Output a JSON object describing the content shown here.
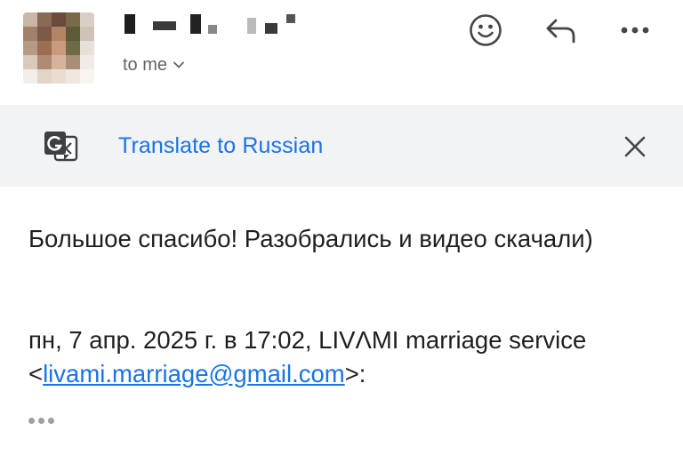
{
  "header": {
    "recipient_text": "to me",
    "icons": [
      "emoji-icon",
      "reply-icon",
      "more-icon"
    ]
  },
  "translate_bar": {
    "link_label": "Translate to Russian",
    "icon": "google-translate-icon",
    "close_icon": "close-icon"
  },
  "message": {
    "line1": "Большое спасибо! Разобрались и видео скачали)",
    "quote_prefix": "пн, 7 апр. 2025 г. в 17:02, LIVΛMI marriage service <",
    "quote_email": "livami.marriage@gmail.com",
    "quote_suffix": ">:"
  },
  "colors": {
    "link": "#1a73e8",
    "bar_bg": "#f1f3f4",
    "icon_gray": "#5f6368"
  }
}
